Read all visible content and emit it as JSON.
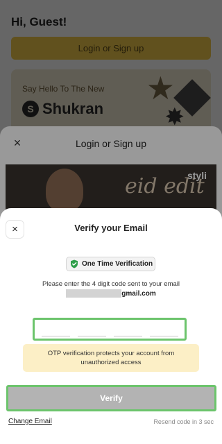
{
  "background": {
    "greeting": "Hi, Guest!",
    "login_button": "Login or Sign up",
    "promo": {
      "subtitle": "Say Hello To The New",
      "badge_letter": "S",
      "brand": "Shukran"
    }
  },
  "login_sheet": {
    "title": "Login or Sign up",
    "close_icon": "×",
    "banner": {
      "headline": "eid edit",
      "logo": "styli"
    }
  },
  "verify_sheet": {
    "title": "Verify your Email",
    "close_icon": "×",
    "badge": "One Time Verification",
    "badge_icon_color": "#2e9e4a",
    "instruction": "Please enter the 4 digit code sent to your email",
    "email_domain": "gmail.com",
    "otp_digit_count": 4,
    "notice": "OTP verification protects your account from unauthorized access",
    "verify_button": "Verify",
    "change_email": "Change Email",
    "resend": "Resend code in 3 sec",
    "highlight_color": "#6cc46c"
  }
}
